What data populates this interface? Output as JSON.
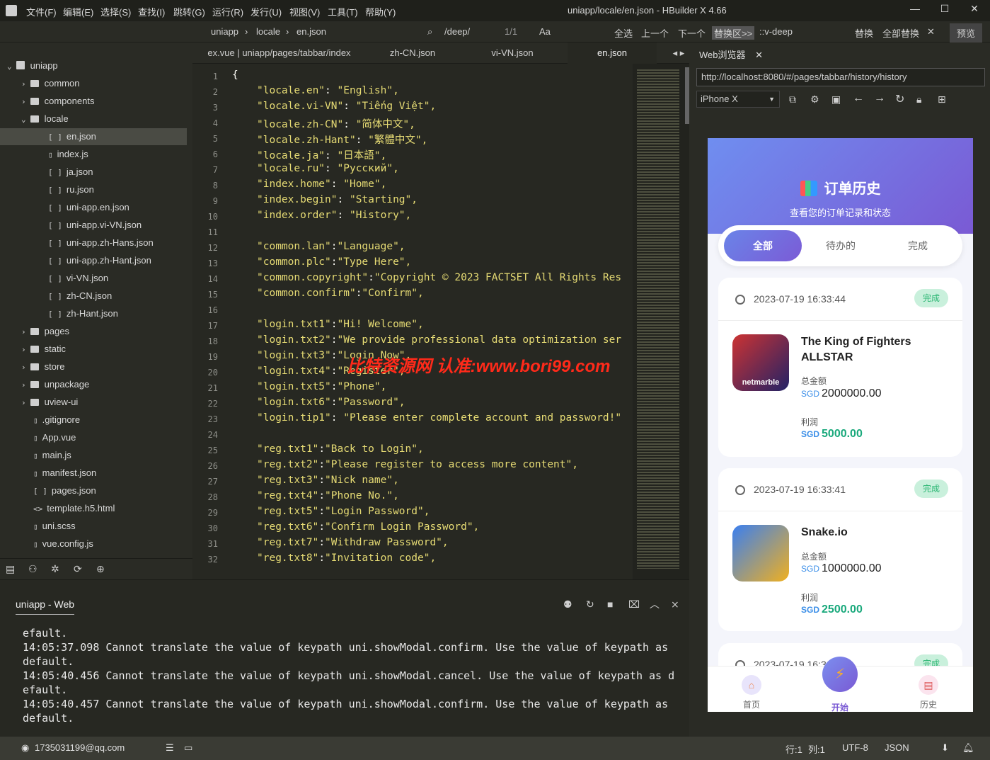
{
  "menu": [
    "文件(F)",
    "编辑(E)",
    "选择(S)",
    "查找(I)",
    "跳转(G)",
    "运行(R)",
    "发行(U)",
    "视图(V)",
    "工具(T)",
    "帮助(Y)"
  ],
  "window_title": "uniapp/locale/en.json - HBuilder X 4.66",
  "toolbar": {
    "breadcrumb": [
      "uniapp",
      "locale",
      "en.json"
    ],
    "search_value": "/deep/",
    "match_count": "1/1",
    "select_all": "全选",
    "prev": "上一个",
    "next": "下一个",
    "replace_area": "替换区>>",
    "replace_value": "::v-deep",
    "replace": "替换",
    "replace_all": "全部替换",
    "preview": "预览"
  },
  "sidebar": {
    "root": "uniapp",
    "items": [
      {
        "label": "common",
        "type": "folder",
        "level": 1
      },
      {
        "label": "components",
        "type": "folder",
        "level": 1
      },
      {
        "label": "locale",
        "type": "folder",
        "level": 1,
        "open": true
      },
      {
        "label": "en.json",
        "type": "json",
        "level": 2,
        "selected": true
      },
      {
        "label": "index.js",
        "type": "js",
        "level": 2
      },
      {
        "label": "ja.json",
        "type": "json",
        "level": 2
      },
      {
        "label": "ru.json",
        "type": "json",
        "level": 2
      },
      {
        "label": "uni-app.en.json",
        "type": "json",
        "level": 2
      },
      {
        "label": "uni-app.vi-VN.json",
        "type": "json",
        "level": 2
      },
      {
        "label": "uni-app.zh-Hans.json",
        "type": "json",
        "level": 2
      },
      {
        "label": "uni-app.zh-Hant.json",
        "type": "json",
        "level": 2
      },
      {
        "label": "vi-VN.json",
        "type": "json",
        "level": 2
      },
      {
        "label": "zh-CN.json",
        "type": "json",
        "level": 2
      },
      {
        "label": "zh-Hant.json",
        "type": "json",
        "level": 2
      },
      {
        "label": "pages",
        "type": "folder",
        "level": 1
      },
      {
        "label": "static",
        "type": "folder",
        "level": 1
      },
      {
        "label": "store",
        "type": "folder",
        "level": 1
      },
      {
        "label": "unpackage",
        "type": "folder",
        "level": 1
      },
      {
        "label": "uview-ui",
        "type": "folder",
        "level": 1
      },
      {
        "label": ".gitignore",
        "type": "file",
        "level": 1
      },
      {
        "label": "App.vue",
        "type": "file",
        "level": 1
      },
      {
        "label": "main.js",
        "type": "file",
        "level": 1
      },
      {
        "label": "manifest.json",
        "type": "file",
        "level": 1
      },
      {
        "label": "pages.json",
        "type": "json",
        "level": 1
      },
      {
        "label": "template.h5.html",
        "type": "html",
        "level": 1
      },
      {
        "label": "uni.scss",
        "type": "file",
        "level": 1
      },
      {
        "label": "vue.config.js",
        "type": "file",
        "level": 1
      }
    ]
  },
  "tabs": [
    "ex.vue | uniapp/pages/tabbar/index",
    "zh-CN.json",
    "vi-VN.json",
    "en.json"
  ],
  "editor_lines": [
    {
      "n": "1",
      "c": "{"
    },
    {
      "n": "2",
      "k": "\"locale.en\"",
      "v": "\"English\","
    },
    {
      "n": "3",
      "k": "\"locale.vi-VN\"",
      "v": "\"Tiếng Việt\","
    },
    {
      "n": "4",
      "k": "\"locale.zh-CN\"",
      "v": "\"简体中文\","
    },
    {
      "n": "5",
      "k": "\"locale.zh-Hant\"",
      "v": "\"繁體中文\","
    },
    {
      "n": "6",
      "k": "\"locale.ja\"",
      "v": "\"日本語\","
    },
    {
      "n": "7",
      "k": "\"locale.ru\"",
      "v": "\"Русский\","
    },
    {
      "n": "8",
      "k": "\"index.home\"",
      "v": "\"Home\","
    },
    {
      "n": "9",
      "k": "\"index.begin\"",
      "v": "\"Starting\","
    },
    {
      "n": "10",
      "k": "\"index.order\"",
      "v": "\"History\","
    },
    {
      "n": "11",
      "c": ""
    },
    {
      "n": "12",
      "k": "\"common.lan\"",
      "v": "\"Language\",",
      "t": 1
    },
    {
      "n": "13",
      "k": "\"common.plc\"",
      "v": "\"Type Here\",",
      "t": 1
    },
    {
      "n": "14",
      "k": "\"common.copyright\"",
      "v": "\"Copyright © 2023 FACTSET All Rights Res",
      "t": 1
    },
    {
      "n": "15",
      "k": "\"common.confirm\"",
      "v": "\"Confirm\",",
      "t": 1
    },
    {
      "n": "16",
      "c": ""
    },
    {
      "n": "17",
      "k": "\"login.txt1\"",
      "v": "\"Hi! Welcome\",",
      "t": 1
    },
    {
      "n": "18",
      "k": "\"login.txt2\"",
      "v": "\"We provide professional data optimization ser",
      "t": 1
    },
    {
      "n": "19",
      "k": "\"login.txt3\"",
      "v": "\"Login Now\",",
      "t": 1
    },
    {
      "n": "20",
      "k": "\"login.txt4\"",
      "v": "\"Register\",",
      "t": 1
    },
    {
      "n": "21",
      "k": "\"login.txt5\"",
      "v": "\"Phone\",",
      "t": 1
    },
    {
      "n": "22",
      "k": "\"login.txt6\"",
      "v": "\"Password\",",
      "t": 1
    },
    {
      "n": "23",
      "k": "\"login.tip1\"",
      "v": "\"Please enter complete account and password!\""
    },
    {
      "n": "24",
      "c": ""
    },
    {
      "n": "25",
      "k": "\"reg.txt1\"",
      "v": "\"Back to Login\",",
      "t": 1
    },
    {
      "n": "26",
      "k": "\"reg.txt2\"",
      "v": "\"Please register to access more content\",",
      "t": 1
    },
    {
      "n": "27",
      "k": "\"reg.txt3\"",
      "v": "\"Nick name\",",
      "t": 1
    },
    {
      "n": "28",
      "k": "\"reg.txt4\"",
      "v": "\"Phone No.\",",
      "t": 1
    },
    {
      "n": "29",
      "k": "\"reg.txt5\"",
      "v": "\"Login Password\",",
      "t": 1
    },
    {
      "n": "30",
      "k": "\"reg.txt6\"",
      "v": "\"Confirm Login Password\",",
      "t": 1
    },
    {
      "n": "31",
      "k": "\"reg.txt7\"",
      "v": "\"Withdraw Password\",",
      "t": 1
    },
    {
      "n": "32",
      "k": "\"reg.txt8\"",
      "v": "\"Invitation code\",",
      "t": 1
    }
  ],
  "watermark": "比特资源网 认准:www.bori99.com",
  "browser": {
    "tab": "Web浏览器",
    "url": "http://localhost:8080/#/pages/tabbar/history/history",
    "device": "iPhone X"
  },
  "app": {
    "title": "订单历史",
    "subtitle": "查看您的订单记录和状态",
    "filters": [
      "全部",
      "待办的",
      "完成"
    ],
    "orders": [
      {
        "date": "2023-07-19 16:33:44",
        "status": "完成",
        "name": "The King of Fighters ALLSTAR",
        "total_label": "总金额",
        "currency": "SGD",
        "total": "2000000.00",
        "profit_label": "利润",
        "profit": "5000.00",
        "thumb_text": "netmarble"
      },
      {
        "date": "2023-07-19 16:33:41",
        "status": "完成",
        "name": "Snake.io",
        "total_label": "总金额",
        "currency": "SGD",
        "total": "1000000.00",
        "profit_label": "利润",
        "profit": "2500.00"
      },
      {
        "date": "2023-07-19 16:3",
        "status": "完成"
      }
    ],
    "nav": [
      "首页",
      "开始",
      "历史"
    ]
  },
  "console": {
    "tab": "uniapp - Web",
    "lines": [
      "efault.",
      "14:05:37.098 Cannot translate the value of keypath uni.showModal.confirm. Use the value of keypath as",
      "default.",
      "14:05:40.456 Cannot translate the value of keypath uni.showModal.cancel. Use the value of keypath as d",
      "efault.",
      "14:05:40.457 Cannot translate the value of keypath uni.showModal.confirm. Use the value of keypath as",
      "default."
    ]
  },
  "status": {
    "user": "1735031199@qq.com",
    "row": "行:1",
    "col": "列:1",
    "encoding": "UTF-8",
    "lang": "JSON"
  }
}
